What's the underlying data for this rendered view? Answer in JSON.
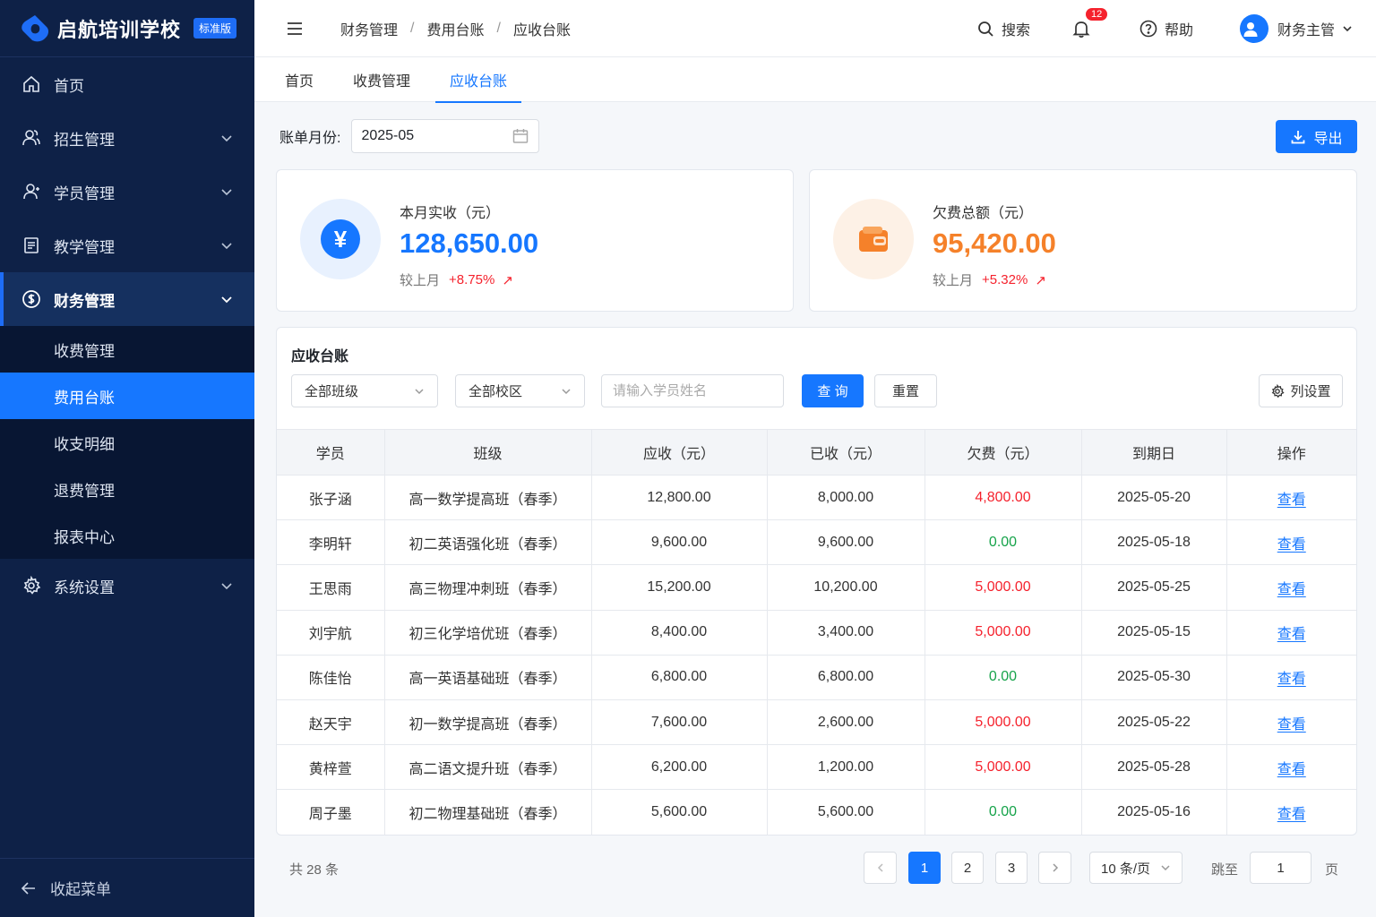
{
  "brand": {
    "name": "启航培训学校",
    "badge": "标准版"
  },
  "sidebar": {
    "items": [
      {
        "label": "首页",
        "icon": "home-icon"
      },
      {
        "label": "招生管理",
        "icon": "users-icon"
      },
      {
        "label": "学员管理",
        "icon": "user-icon"
      },
      {
        "label": "教学管理",
        "icon": "document-icon"
      },
      {
        "label": "财务管理",
        "icon": "dollar-icon"
      },
      {
        "label": "系统设置",
        "icon": "gear-icon"
      }
    ],
    "submenu": [
      {
        "label": "收费管理"
      },
      {
        "label": "费用台账"
      },
      {
        "label": "收支明细"
      },
      {
        "label": "退费管理"
      },
      {
        "label": "报表中心"
      }
    ],
    "collapse_label": "收起菜单"
  },
  "header": {
    "breadcrumb": [
      "财务管理",
      "费用台账",
      "应收台账"
    ],
    "separator": "/",
    "search_label": "搜索",
    "notification_count": "12",
    "help_label": "帮助",
    "user_name": "财务主管"
  },
  "tabs": [
    {
      "label": "首页"
    },
    {
      "label": "收费管理"
    },
    {
      "label": "应收台账"
    }
  ],
  "toolbar": {
    "month_label": "账单月份:",
    "month_value": "2025-05",
    "export_label": "导出"
  },
  "stats": {
    "received": {
      "label": "本月实收（元）",
      "value": "128,650.00",
      "compare_label": "较上月",
      "change": "+8.75%",
      "arrow": "↗",
      "color": "#1677ff"
    },
    "arrears": {
      "label": "欠费总额（元）",
      "value": "95,420.00",
      "compare_label": "较上月",
      "change": "+5.32%",
      "arrow": "↗",
      "color": "#f5812a"
    }
  },
  "ledger": {
    "title": "应收台账",
    "class_select": "全部班级",
    "campus_select": "全部校区",
    "name_placeholder": "请输入学员姓名",
    "query_label": "查 询",
    "reset_label": "重置",
    "columns_label": "列设置",
    "headers": [
      "学员",
      "班级",
      "应收（元）",
      "已收（元）",
      "欠费（元）",
      "到期日",
      "操作"
    ],
    "rows": [
      {
        "student": "张子涵",
        "class": "高一数学提高班（春季）",
        "due": "12,800.00",
        "paid": "8,000.00",
        "owed": "4,800.00",
        "owed_status": "red",
        "date": "2025-05-20",
        "action": "查看"
      },
      {
        "student": "李明轩",
        "class": "初二英语强化班（春季）",
        "due": "9,600.00",
        "paid": "9,600.00",
        "owed": "0.00",
        "owed_status": "green",
        "date": "2025-05-18",
        "action": "查看"
      },
      {
        "student": "王思雨",
        "class": "高三物理冲刺班（春季）",
        "due": "15,200.00",
        "paid": "10,200.00",
        "owed": "5,000.00",
        "owed_status": "red",
        "date": "2025-05-25",
        "action": "查看"
      },
      {
        "student": "刘宇航",
        "class": "初三化学培优班（春季）",
        "due": "8,400.00",
        "paid": "3,400.00",
        "owed": "5,000.00",
        "owed_status": "red",
        "date": "2025-05-15",
        "action": "查看"
      },
      {
        "student": "陈佳怡",
        "class": "高一英语基础班（春季）",
        "due": "6,800.00",
        "paid": "6,800.00",
        "owed": "0.00",
        "owed_status": "green",
        "date": "2025-05-30",
        "action": "查看"
      },
      {
        "student": "赵天宇",
        "class": "初一数学提高班（春季）",
        "due": "7,600.00",
        "paid": "2,600.00",
        "owed": "5,000.00",
        "owed_status": "red",
        "date": "2025-05-22",
        "action": "查看"
      },
      {
        "student": "黄梓萱",
        "class": "高二语文提升班（春季）",
        "due": "6,200.00",
        "paid": "1,200.00",
        "owed": "5,000.00",
        "owed_status": "red",
        "date": "2025-05-28",
        "action": "查看"
      },
      {
        "student": "周子墨",
        "class": "初二物理基础班（春季）",
        "due": "5,600.00",
        "paid": "5,600.00",
        "owed": "0.00",
        "owed_status": "green",
        "date": "2025-05-16",
        "action": "查看"
      }
    ]
  },
  "pagination": {
    "total": "共 28 条",
    "pages": [
      "1",
      "2",
      "3"
    ],
    "current": "1",
    "page_size": "10 条/页",
    "jump_label": "跳至",
    "jump_value": "1",
    "page_suffix": "页"
  }
}
